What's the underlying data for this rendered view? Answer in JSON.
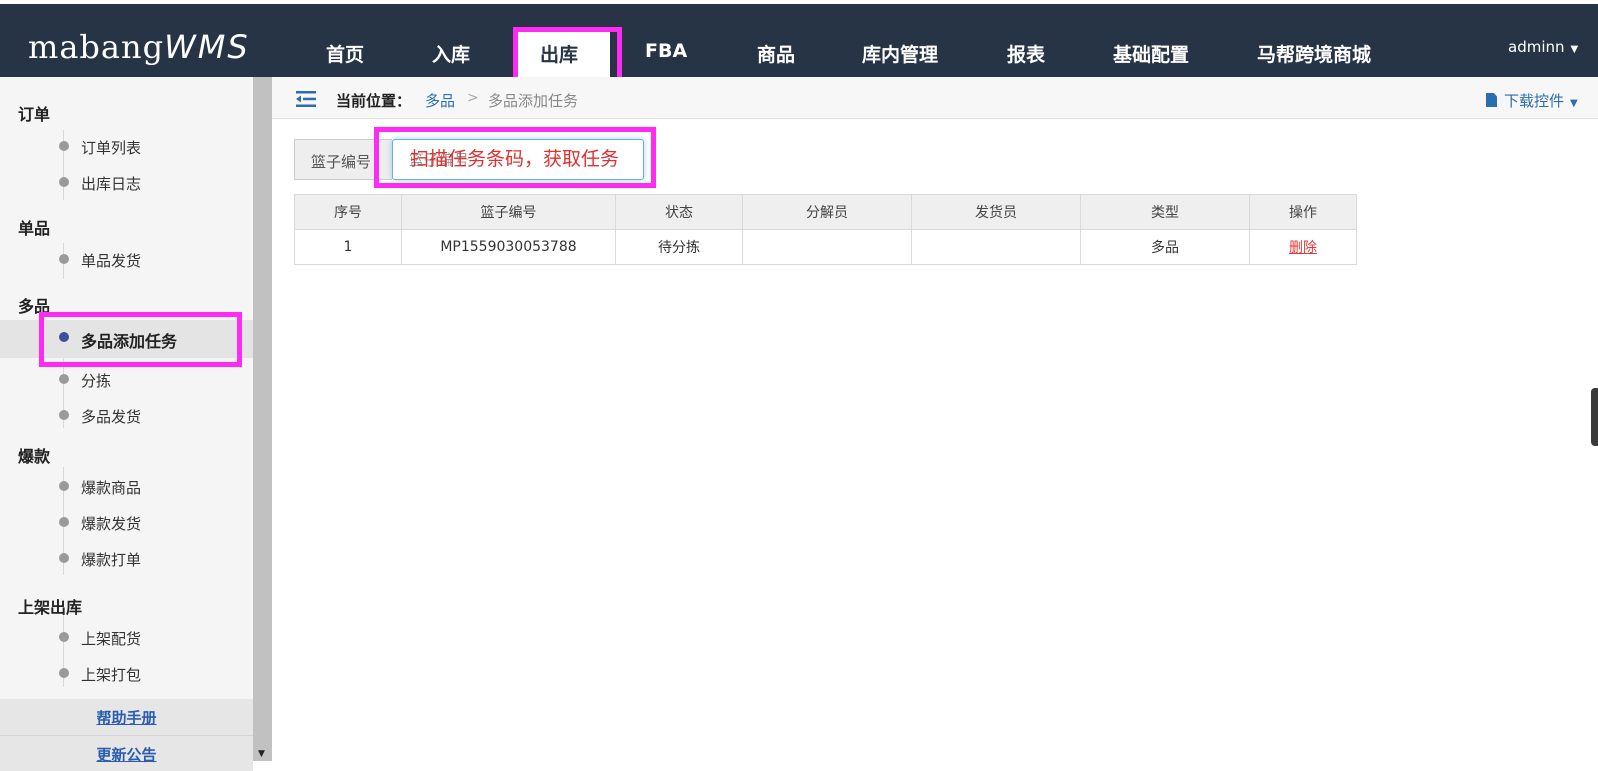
{
  "header": {
    "logo_main": "mabang",
    "logo_suffix": "WMS",
    "nav": [
      "首页",
      "入库",
      "出库",
      "FBA",
      "商品",
      "库内管理",
      "报表",
      "基础配置",
      "马帮跨境商城"
    ],
    "active_nav": "出库",
    "user": "adminn"
  },
  "sidebar": {
    "groups": [
      {
        "title": "订单",
        "items": [
          "订单列表",
          "出库日志"
        ]
      },
      {
        "title": "单品",
        "items": [
          "单品发货"
        ]
      },
      {
        "title": "多品",
        "items": [
          "多品添加任务",
          "分拣",
          "多品发货"
        ]
      },
      {
        "title": "爆款",
        "items": [
          "爆款商品",
          "爆款发货",
          "爆款打单"
        ]
      },
      {
        "title": "上架出库",
        "items": [
          "上架配货",
          "上架打包"
        ]
      }
    ],
    "active_item": "多品添加任务",
    "footer": [
      "帮助手册",
      "更新公告"
    ]
  },
  "breadcrumb": {
    "label": "当前位置：",
    "parent": "多品",
    "separator": ">",
    "current": "多品添加任务"
  },
  "toolbar": {
    "download_label": "下载控件"
  },
  "search": {
    "addon_label": "篮子编号",
    "placeholder": "篮子编号",
    "value": "",
    "annotation": "扫描任务条码，获取任务"
  },
  "table": {
    "columns": [
      "序号",
      "篮子编号",
      "状态",
      "分解员",
      "发货员",
      "类型",
      "操作"
    ],
    "rows": [
      {
        "index": "1",
        "basket": "MP1559030053788",
        "status": "待分拣",
        "splitter": "",
        "shipper": "",
        "type": "多品",
        "action": "删除"
      }
    ]
  },
  "colors": {
    "topbar": "#263445",
    "highlight": "#ff2bf2",
    "link": "#2a6db0",
    "danger": "#e23a3a"
  }
}
